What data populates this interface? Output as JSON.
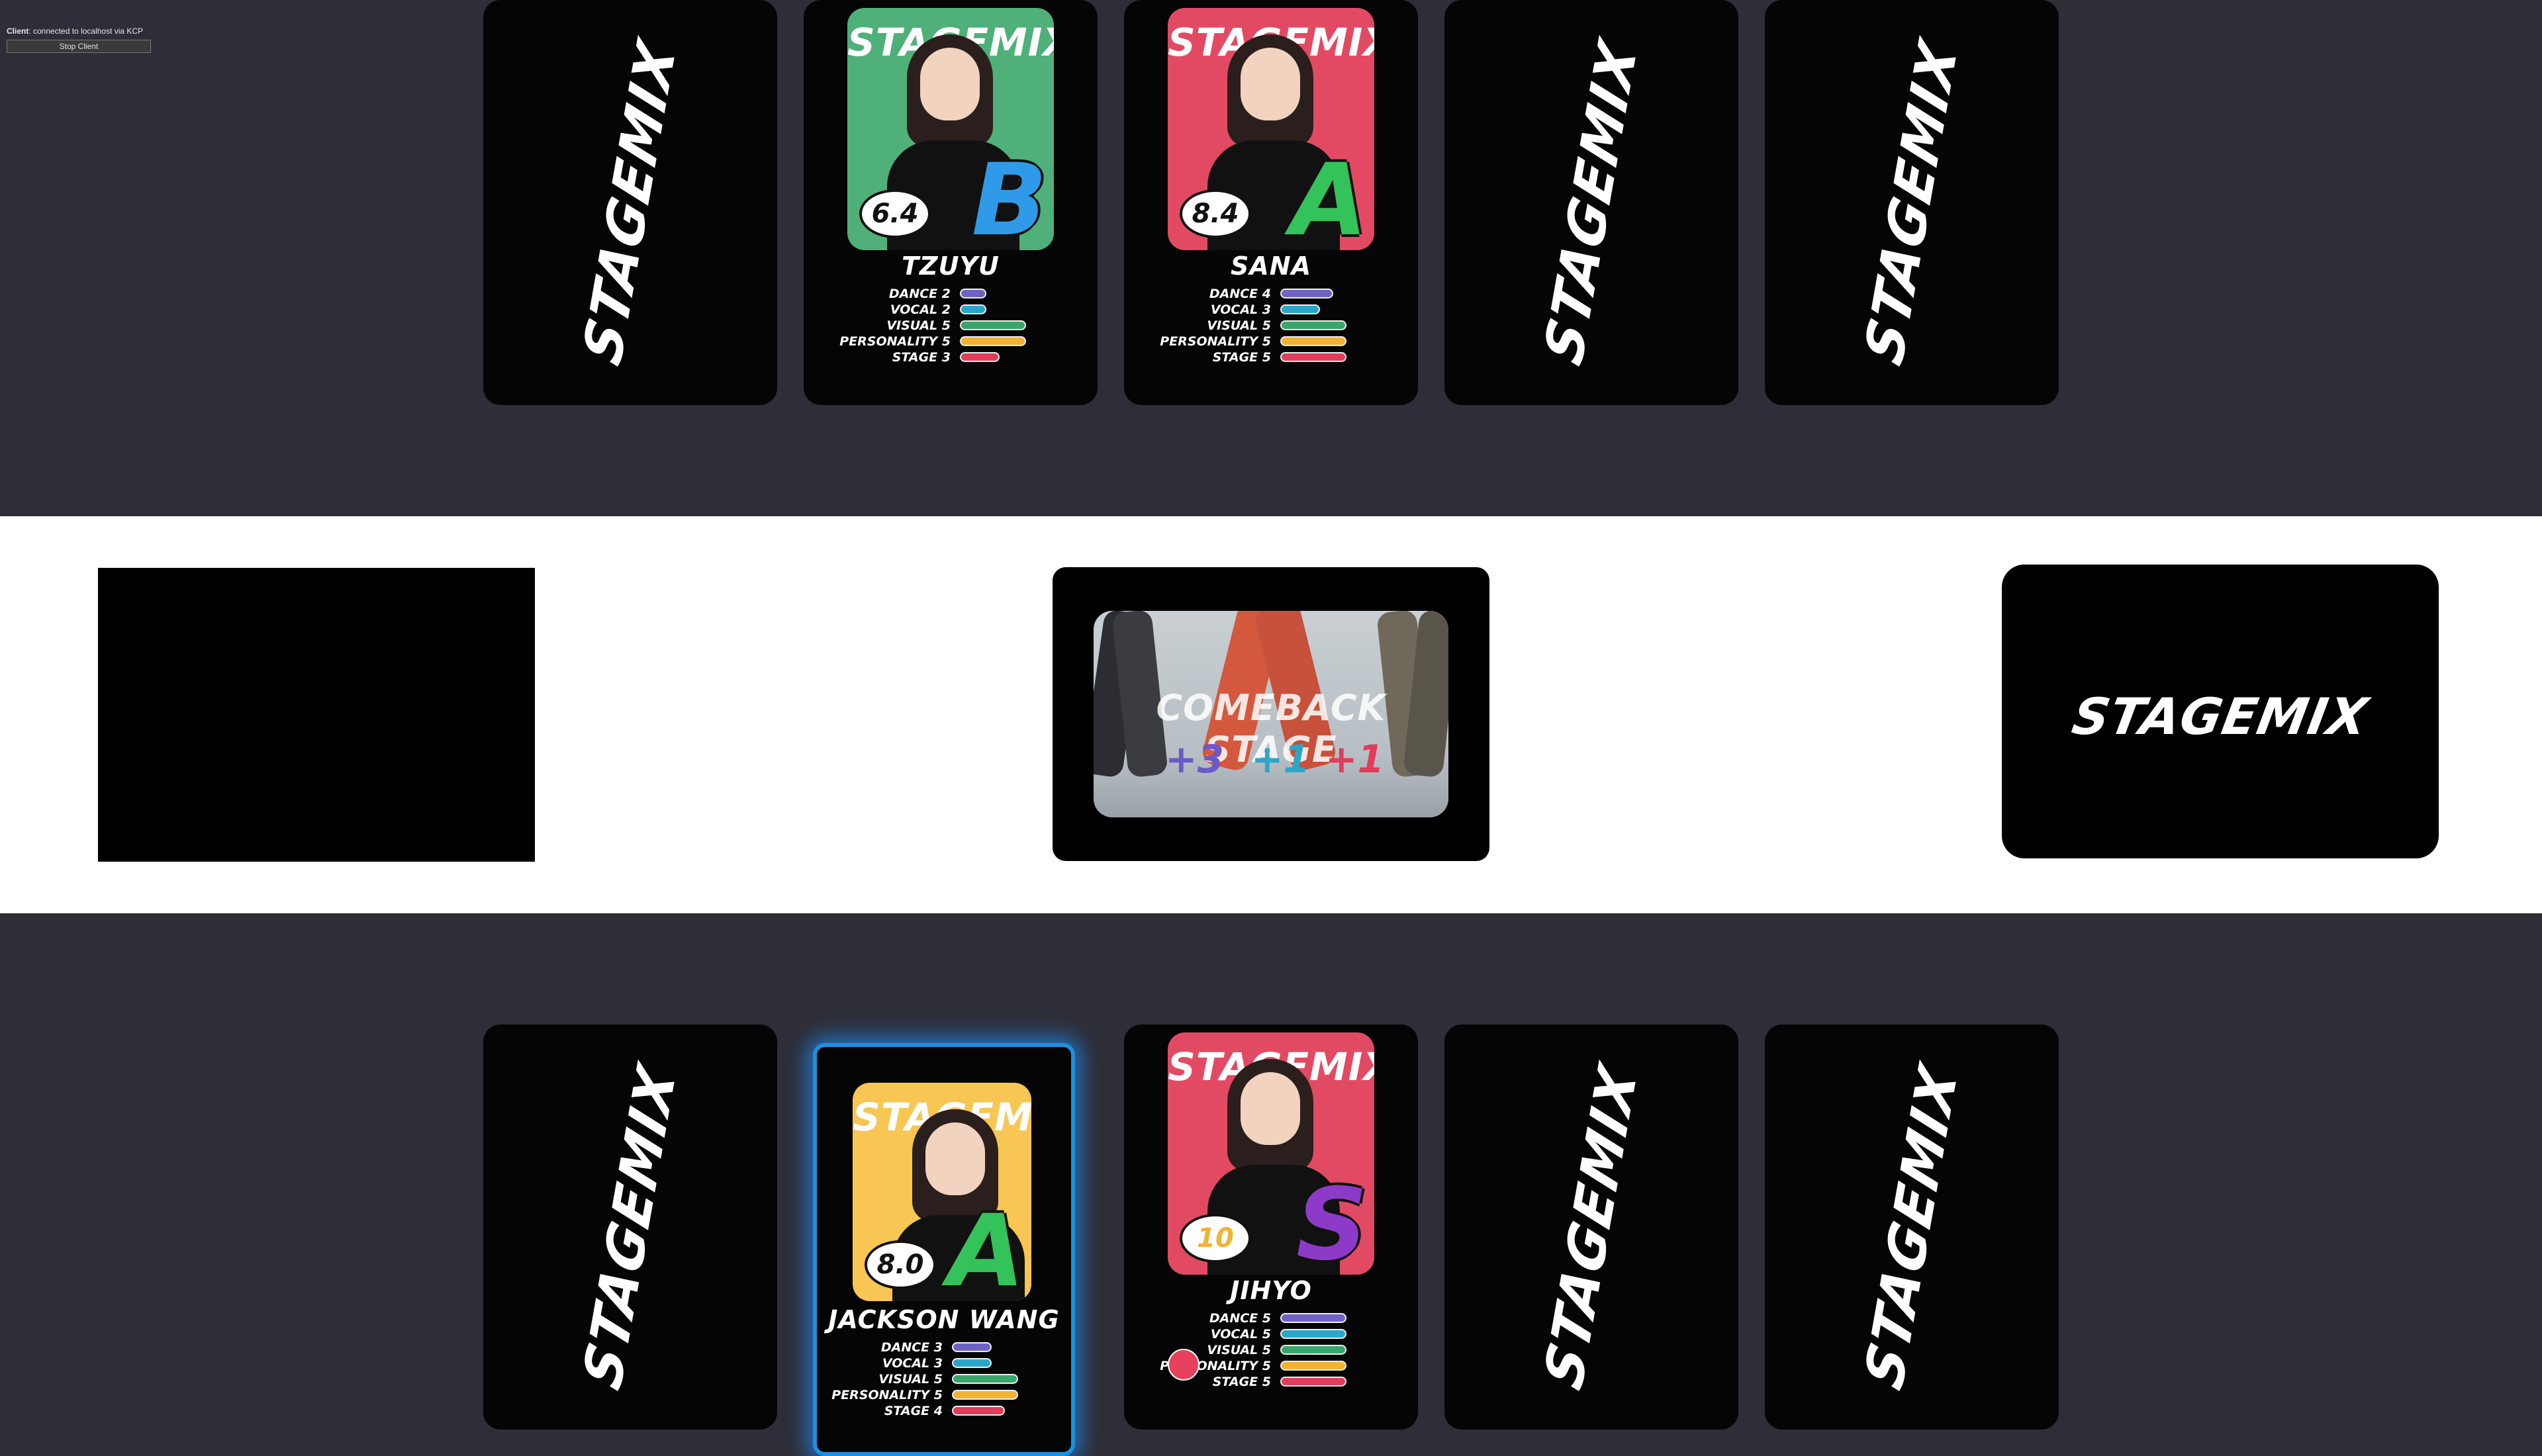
{
  "client_panel": {
    "label": "Client",
    "status": ": connected to localhost via KCP",
    "stop_button": "Stop Client"
  },
  "brand": "STAGEMIX",
  "opponent_hand": [
    {
      "face": "down"
    },
    {
      "face": "up",
      "name": "TZUYU",
      "score": "6.4",
      "grade": "B",
      "bg": "#4fb07a",
      "grade_color": "#2f9be8",
      "stats": [
        {
          "label": "DANCE 2",
          "value": 2
        },
        {
          "label": "VOCAL 2",
          "value": 2
        },
        {
          "label": "VISUAL 5",
          "value": 5
        },
        {
          "label": "PERSONALITY 5",
          "value": 5
        },
        {
          "label": "STAGE 3",
          "value": 3
        }
      ]
    },
    {
      "face": "up",
      "name": "SANA",
      "score": "8.4",
      "grade": "A",
      "bg": "#e24a63",
      "grade_color": "#34c25a",
      "stats": [
        {
          "label": "DANCE 4",
          "value": 4
        },
        {
          "label": "VOCAL 3",
          "value": 3
        },
        {
          "label": "VISUAL 5",
          "value": 5
        },
        {
          "label": "PERSONALITY 5",
          "value": 5
        },
        {
          "label": "STAGE 5",
          "value": 5
        }
      ]
    },
    {
      "face": "down"
    },
    {
      "face": "down"
    }
  ],
  "stage": {
    "title": "COMEBACK STAGE",
    "bonuses": [
      "+3",
      "+1",
      "+1"
    ],
    "bonus_colors": [
      "#6a59c9",
      "#2ba6c9",
      "#e23c5b"
    ]
  },
  "player_hand": [
    {
      "face": "down"
    },
    {
      "face": "up",
      "selected": true,
      "name": "JACKSON WANG",
      "score": "8.0",
      "grade": "A",
      "bg": "#f7c653",
      "grade_color": "#34c25a",
      "stats": [
        {
          "label": "DANCE 3",
          "value": 3
        },
        {
          "label": "VOCAL 3",
          "value": 3
        },
        {
          "label": "VISUAL 5",
          "value": 5
        },
        {
          "label": "PERSONALITY 5",
          "value": 5
        },
        {
          "label": "STAGE 4",
          "value": 4
        }
      ]
    },
    {
      "face": "up",
      "name": "JIHYO",
      "score": "10",
      "grade": "S",
      "bg": "#e24a63",
      "grade_color": "#8e3ac8",
      "score_color": "#f2b233",
      "token": true,
      "stats": [
        {
          "label": "DANCE 5",
          "value": 5
        },
        {
          "label": "VOCAL 5",
          "value": 5
        },
        {
          "label": "VISUAL 5",
          "value": 5
        },
        {
          "label": "PERSONALITY 5",
          "value": 5
        },
        {
          "label": "STAGE 5",
          "value": 5
        }
      ]
    },
    {
      "face": "down"
    },
    {
      "face": "down"
    }
  ],
  "stat_colors": [
    "#6e63c4",
    "#2ba6c9",
    "#3aa56b",
    "#f2b233",
    "#e23c5b"
  ]
}
